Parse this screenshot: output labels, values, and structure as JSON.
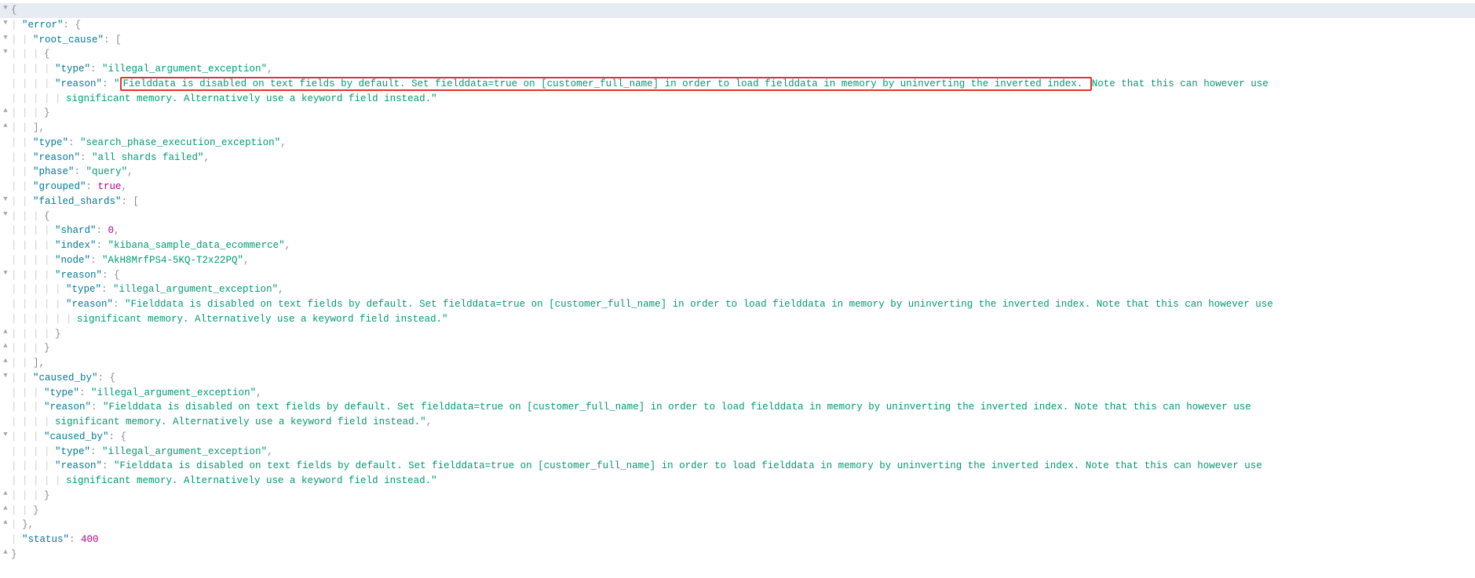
{
  "indentWidth": 14,
  "colors": {
    "key": "#007997",
    "string": "#009a73",
    "number": "#b5008a",
    "keyword": "#b5008a",
    "punc": "#8c8c8c",
    "pipe": "#d0d0d0",
    "gutter": "#a6a6a6",
    "highlightBorder": "#e63131",
    "topBarBg": "#e6ecf2"
  },
  "json_error": {
    "error": {
      "root_cause": [
        {
          "type": "illegal_argument_exception",
          "reason": "Fielddata is disabled on text fields by default. Set fielddata=true on [customer_full_name] in order to load fielddata in memory by uninverting the inverted index. Note that this can however use significant memory. Alternatively use a keyword field instead."
        }
      ],
      "type": "search_phase_execution_exception",
      "reason": "all shards failed",
      "phase": "query",
      "grouped": true,
      "failed_shards": [
        {
          "shard": 0,
          "index": "kibana_sample_data_ecommerce",
          "node": "AkH8MrfPS4-5KQ-T2x22PQ",
          "reason": {
            "type": "illegal_argument_exception",
            "reason": "Fielddata is disabled on text fields by default. Set fielddata=true on [customer_full_name] in order to load fielddata in memory by uninverting the inverted index. Note that this can however use significant memory. Alternatively use a keyword field instead."
          }
        }
      ],
      "caused_by": {
        "type": "illegal_argument_exception",
        "reason": "Fielddata is disabled on text fields by default. Set fielddata=true on [customer_full_name] in order to load fielddata in memory by uninverting the inverted index. Note that this can however use significant memory. Alternatively use a keyword field instead.",
        "caused_by": {
          "type": "illegal_argument_exception",
          "reason": "Fielddata is disabled on text fields by default. Set fielddata=true on [customer_full_name] in order to load fielddata in memory by uninverting the inverted index. Note that this can however use significant memory. Alternatively use a keyword field instead."
        }
      }
    },
    "status": 400
  },
  "highlight": {
    "text": "Fielddata is disabled on text fields by default. Set fielddata=true on [customer_full_name] in order to load fielddata in memory by uninverting the inverted index. "
  },
  "lines": [
    {
      "gutter": "collapse",
      "indent": 0,
      "first": true,
      "tokens": [
        [
          "punc",
          "{"
        ]
      ]
    },
    {
      "gutter": "collapse",
      "indent": 1,
      "tokens": [
        [
          "key",
          "\"error\""
        ],
        [
          "punc",
          ": {"
        ]
      ]
    },
    {
      "gutter": "collapse",
      "indent": 2,
      "tokens": [
        [
          "key",
          "\"root_cause\""
        ],
        [
          "punc",
          ": ["
        ]
      ]
    },
    {
      "gutter": "collapse",
      "indent": 3,
      "tokens": [
        [
          "punc",
          "{"
        ]
      ]
    },
    {
      "gutter": "",
      "indent": 4,
      "tokens": [
        [
          "key",
          "\"type\""
        ],
        [
          "punc",
          ": "
        ],
        [
          "str",
          "\"illegal_argument_exception\""
        ],
        [
          "punc",
          ","
        ]
      ]
    },
    {
      "gutter": "",
      "indent": 4,
      "reasonHighlight": true
    },
    {
      "gutter": "",
      "indent": 5,
      "tokens": [
        [
          "str",
          "significant memory. Alternatively use a keyword field instead.\""
        ]
      ]
    },
    {
      "gutter": "expand",
      "indent": 3,
      "tokens": [
        [
          "punc",
          "}"
        ]
      ]
    },
    {
      "gutter": "expand",
      "indent": 2,
      "tokens": [
        [
          "punc",
          "],"
        ]
      ]
    },
    {
      "gutter": "",
      "indent": 2,
      "tokens": [
        [
          "key",
          "\"type\""
        ],
        [
          "punc",
          ": "
        ],
        [
          "str",
          "\"search_phase_execution_exception\""
        ],
        [
          "punc",
          ","
        ]
      ]
    },
    {
      "gutter": "",
      "indent": 2,
      "tokens": [
        [
          "key",
          "\"reason\""
        ],
        [
          "punc",
          ": "
        ],
        [
          "str",
          "\"all shards failed\""
        ],
        [
          "punc",
          ","
        ]
      ]
    },
    {
      "gutter": "",
      "indent": 2,
      "tokens": [
        [
          "key",
          "\"phase\""
        ],
        [
          "punc",
          ": "
        ],
        [
          "str",
          "\"query\""
        ],
        [
          "punc",
          ","
        ]
      ]
    },
    {
      "gutter": "",
      "indent": 2,
      "tokens": [
        [
          "key",
          "\"grouped\""
        ],
        [
          "punc",
          ": "
        ],
        [
          "kw",
          "true"
        ],
        [
          "punc",
          ","
        ]
      ]
    },
    {
      "gutter": "collapse",
      "indent": 2,
      "tokens": [
        [
          "key",
          "\"failed_shards\""
        ],
        [
          "punc",
          ": ["
        ]
      ]
    },
    {
      "gutter": "collapse",
      "indent": 3,
      "tokens": [
        [
          "punc",
          "{"
        ]
      ]
    },
    {
      "gutter": "",
      "indent": 4,
      "tokens": [
        [
          "key",
          "\"shard\""
        ],
        [
          "punc",
          ": "
        ],
        [
          "num",
          "0"
        ],
        [
          "punc",
          ","
        ]
      ]
    },
    {
      "gutter": "",
      "indent": 4,
      "tokens": [
        [
          "key",
          "\"index\""
        ],
        [
          "punc",
          ": "
        ],
        [
          "str",
          "\"kibana_sample_data_ecommerce\""
        ],
        [
          "punc",
          ","
        ]
      ]
    },
    {
      "gutter": "",
      "indent": 4,
      "tokens": [
        [
          "key",
          "\"node\""
        ],
        [
          "punc",
          ": "
        ],
        [
          "str",
          "\"AkH8MrfPS4-5KQ-T2x22PQ\""
        ],
        [
          "punc",
          ","
        ]
      ]
    },
    {
      "gutter": "collapse",
      "indent": 4,
      "tokens": [
        [
          "key",
          "\"reason\""
        ],
        [
          "punc",
          ": {"
        ]
      ]
    },
    {
      "gutter": "",
      "indent": 5,
      "tokens": [
        [
          "key",
          "\"type\""
        ],
        [
          "punc",
          ": "
        ],
        [
          "str",
          "\"illegal_argument_exception\""
        ],
        [
          "punc",
          ","
        ]
      ]
    },
    {
      "gutter": "",
      "indent": 5,
      "tokens": [
        [
          "key",
          "\"reason\""
        ],
        [
          "punc",
          ": "
        ],
        [
          "str",
          "\"Fielddata is disabled on text fields by default. Set fielddata=true on [customer_full_name] in order to load fielddata in memory by uninverting the inverted index. Note that this can however use"
        ]
      ]
    },
    {
      "gutter": "",
      "indent": 6,
      "tokens": [
        [
          "str",
          "significant memory. Alternatively use a keyword field instead.\""
        ]
      ]
    },
    {
      "gutter": "expand",
      "indent": 4,
      "tokens": [
        [
          "punc",
          "}"
        ]
      ]
    },
    {
      "gutter": "expand",
      "indent": 3,
      "tokens": [
        [
          "punc",
          "}"
        ]
      ]
    },
    {
      "gutter": "expand",
      "indent": 2,
      "tokens": [
        [
          "punc",
          "],"
        ]
      ]
    },
    {
      "gutter": "collapse",
      "indent": 2,
      "tokens": [
        [
          "key",
          "\"caused_by\""
        ],
        [
          "punc",
          ": {"
        ]
      ]
    },
    {
      "gutter": "",
      "indent": 3,
      "tokens": [
        [
          "key",
          "\"type\""
        ],
        [
          "punc",
          ": "
        ],
        [
          "str",
          "\"illegal_argument_exception\""
        ],
        [
          "punc",
          ","
        ]
      ]
    },
    {
      "gutter": "",
      "indent": 3,
      "tokens": [
        [
          "key",
          "\"reason\""
        ],
        [
          "punc",
          ": "
        ],
        [
          "str",
          "\"Fielddata is disabled on text fields by default. Set fielddata=true on [customer_full_name] in order to load fielddata in memory by uninverting the inverted index. Note that this can however use"
        ]
      ]
    },
    {
      "gutter": "",
      "indent": 4,
      "tokens": [
        [
          "str",
          "significant memory. Alternatively use a keyword field instead.\""
        ],
        [
          "punc",
          ","
        ]
      ]
    },
    {
      "gutter": "collapse",
      "indent": 3,
      "tokens": [
        [
          "key",
          "\"caused_by\""
        ],
        [
          "punc",
          ": {"
        ]
      ]
    },
    {
      "gutter": "",
      "indent": 4,
      "tokens": [
        [
          "key",
          "\"type\""
        ],
        [
          "punc",
          ": "
        ],
        [
          "str",
          "\"illegal_argument_exception\""
        ],
        [
          "punc",
          ","
        ]
      ]
    },
    {
      "gutter": "",
      "indent": 4,
      "tokens": [
        [
          "key",
          "\"reason\""
        ],
        [
          "punc",
          ": "
        ],
        [
          "str",
          "\"Fielddata is disabled on text fields by default. Set fielddata=true on [customer_full_name] in order to load fielddata in memory by uninverting the inverted index. Note that this can however use"
        ]
      ]
    },
    {
      "gutter": "",
      "indent": 5,
      "tokens": [
        [
          "str",
          "significant memory. Alternatively use a keyword field instead.\""
        ]
      ]
    },
    {
      "gutter": "expand",
      "indent": 3,
      "tokens": [
        [
          "punc",
          "}"
        ]
      ]
    },
    {
      "gutter": "expand",
      "indent": 2,
      "tokens": [
        [
          "punc",
          "}"
        ]
      ]
    },
    {
      "gutter": "expand",
      "indent": 1,
      "tokens": [
        [
          "punc",
          "},"
        ]
      ]
    },
    {
      "gutter": "",
      "indent": 1,
      "tokens": [
        [
          "key",
          "\"status\""
        ],
        [
          "punc",
          ": "
        ],
        [
          "num",
          "400"
        ]
      ]
    },
    {
      "gutter": "expand",
      "indent": 0,
      "tokens": [
        [
          "punc",
          "}"
        ]
      ]
    }
  ]
}
